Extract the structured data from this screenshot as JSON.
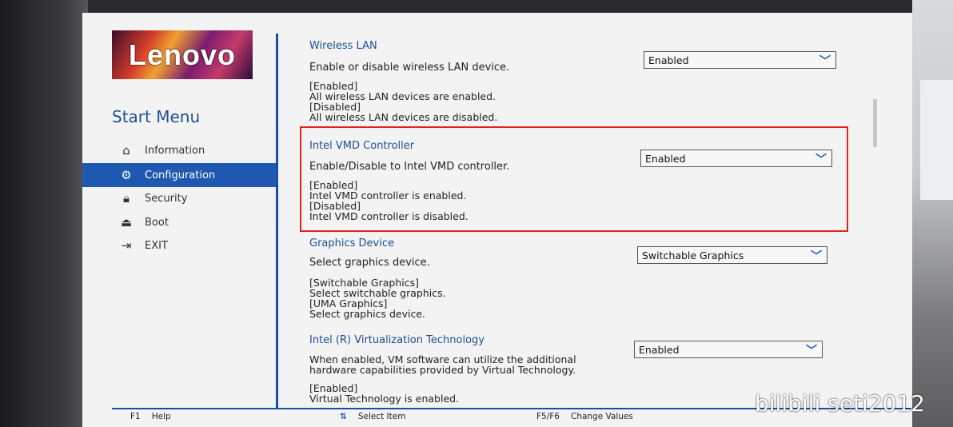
{
  "brand": {
    "logo_text": "Lenovo"
  },
  "sidebar": {
    "title": "Start Menu",
    "items": [
      {
        "label": "Information",
        "icon": "home-icon",
        "active": false
      },
      {
        "label": "Configuration",
        "icon": "config-icon",
        "active": true
      },
      {
        "label": "Security",
        "icon": "lock-icon",
        "active": false
      },
      {
        "label": "Boot",
        "icon": "boot-icon",
        "active": false
      },
      {
        "label": "EXIT",
        "icon": "exit-icon",
        "active": false
      }
    ]
  },
  "settings": [
    {
      "title": "Wireless LAN",
      "description": "Enable or disable wireless LAN device.",
      "help": [
        "[Enabled]",
        "All wireless LAN devices are enabled.",
        "[Disabled]",
        "All wireless LAN devices are disabled."
      ],
      "value": "Enabled"
    },
    {
      "title": "Intel VMD Controller",
      "description": "Enable/Disable to Intel VMD controller.",
      "help": [
        "[Enabled]",
        "Intel VMD controller is enabled.",
        "[Disabled]",
        "Intel VMD controller is disabled."
      ],
      "value": "Enabled",
      "highlighted": true
    },
    {
      "title": "Graphics Device",
      "description": "Select graphics device.",
      "help": [
        "[Switchable Graphics]",
        "Select switchable graphics.",
        "[UMA Graphics]",
        "Select graphics device."
      ],
      "value": "Switchable Graphics"
    },
    {
      "title": "Intel (R) Virtualization Technology",
      "description": "When enabled, VM software can utilize the additional hardware capabilities provided by Virtual Technology.",
      "description_lines": [
        "When enabled, VM software can utilize the additional",
        "hardware capabilities provided by Virtual Technology."
      ],
      "help": [
        "[Enabled]",
        "Virtual Technology is enabled."
      ],
      "value": "Enabled"
    }
  ],
  "footer": {
    "items": [
      {
        "key": "F1",
        "label": "Help"
      },
      {
        "key": "⇅",
        "label": "Select Item"
      },
      {
        "key": "F5/F6",
        "label": "Change Values"
      }
    ]
  },
  "watermark": "bilibili seti2012",
  "colors": {
    "accent": "#1f58b0",
    "highlight_border": "#e02020",
    "title_blue": "#1e4f8f"
  }
}
